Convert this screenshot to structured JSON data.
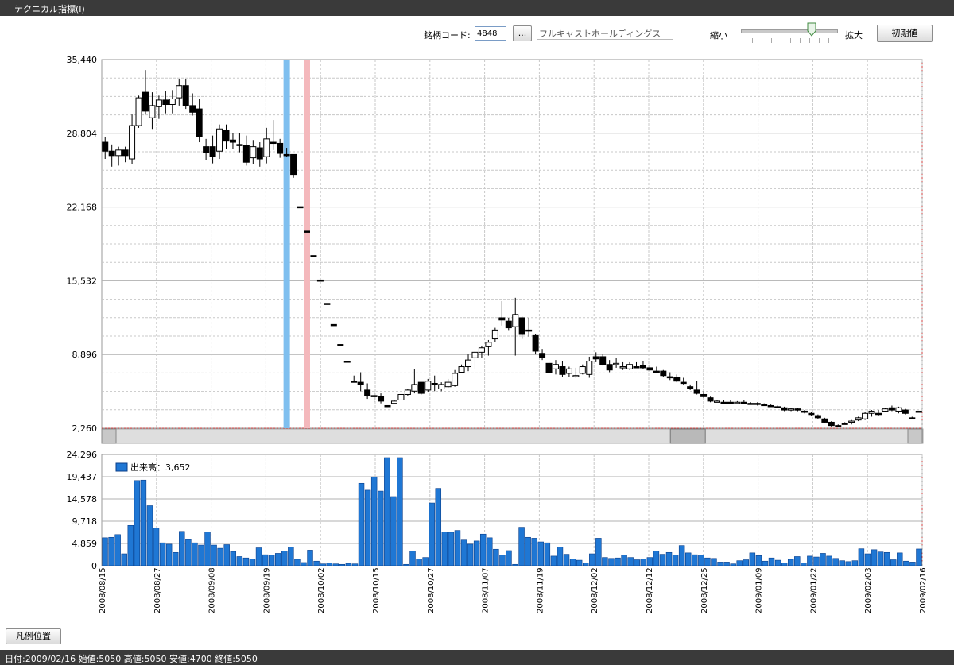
{
  "window": {
    "title": "テクニカル指標(I)"
  },
  "toolbar": {
    "code_label": "銘柄コード:",
    "code_value": "4848",
    "browse_label": "...",
    "company_name": "フルキャストホールディングス",
    "zoom_out_label": "縮小",
    "zoom_in_label": "拡大",
    "reset_label": "初期値",
    "zoom_level": 0.75
  },
  "legend_button_label": "凡例位置",
  "status_text": "日付:2009/02/16  始値:5050  高値:5050  安値:4700  終値:5050",
  "colors": {
    "volume_bar": "#1f77d4",
    "blue_marker": "#7fbfef",
    "pink_marker": "#f4b8bc",
    "up_candle": "#ffffff",
    "down_candle": "#000000",
    "grid": "#c8c8c8"
  },
  "chart_data": [
    {
      "type": "candlestick",
      "ylim": [
        2260,
        35440
      ],
      "yticks": [
        "35,440",
        "28,804",
        "22,168",
        "15,532",
        "8,896",
        "2,260"
      ],
      "markers": [
        {
          "color": "blue",
          "index": 27
        },
        {
          "color": "pink",
          "index": 30
        }
      ],
      "scrollbar_position": 0.7,
      "candles": [
        [
          28000,
          28500,
          26500,
          27200
        ],
        [
          27200,
          27800,
          25800,
          26800
        ],
        [
          26800,
          27600,
          25900,
          27300
        ],
        [
          27300,
          27600,
          26200,
          26800
        ],
        [
          26500,
          30500,
          26000,
          29500
        ],
        [
          29500,
          32200,
          29300,
          32000
        ],
        [
          32500,
          34500,
          30500,
          30800
        ],
        [
          30200,
          32500,
          29200,
          31300
        ],
        [
          31200,
          32200,
          30100,
          31800
        ],
        [
          31800,
          32600,
          30600,
          31400
        ],
        [
          31400,
          32700,
          30600,
          31900
        ],
        [
          32000,
          33700,
          31300,
          33100
        ],
        [
          33100,
          33700,
          31000,
          31300
        ],
        [
          31300,
          32400,
          30400,
          30700
        ],
        [
          31000,
          31900,
          28000,
          28500
        ],
        [
          27600,
          28300,
          26400,
          27100
        ],
        [
          27600,
          28600,
          26100,
          26700
        ],
        [
          27200,
          29600,
          26500,
          29200
        ],
        [
          29100,
          29600,
          27400,
          28100
        ],
        [
          28200,
          28800,
          27400,
          28000
        ],
        [
          27800,
          28800,
          27100,
          27700
        ],
        [
          27700,
          28600,
          25900,
          26200
        ],
        [
          26600,
          28200,
          26000,
          27600
        ],
        [
          27500,
          28000,
          25800,
          26500
        ],
        [
          26700,
          29300,
          26100,
          28300
        ],
        [
          28000,
          30000,
          27300,
          27900
        ],
        [
          27900,
          28300,
          26600,
          27000
        ],
        [
          26900,
          27500,
          26700,
          26800
        ],
        [
          26900,
          26900,
          24800,
          25100
        ],
        [
          22200,
          22200,
          22200,
          22200
        ],
        [
          20000,
          20000,
          20000,
          20000
        ],
        [
          17800,
          17800,
          17800,
          17800
        ],
        [
          15600,
          15600,
          15600,
          15600
        ],
        [
          13500,
          13500,
          13500,
          13500
        ],
        [
          11600,
          11600,
          11600,
          11600
        ],
        [
          9800,
          9800,
          9800,
          9800
        ],
        [
          8300,
          8300,
          8300,
          8300
        ],
        [
          6500,
          7000,
          6400,
          6500
        ],
        [
          6400,
          7300,
          5600,
          6200
        ],
        [
          5700,
          6300,
          4900,
          5200
        ],
        [
          5200,
          5600,
          4600,
          5100
        ],
        [
          5100,
          5400,
          4500,
          4700
        ],
        [
          4300,
          4300,
          4200,
          4300
        ],
        [
          4500,
          4800,
          4500,
          4700
        ],
        [
          4800,
          5300,
          4800,
          5300
        ],
        [
          5300,
          5800,
          5200,
          5700
        ],
        [
          5600,
          7600,
          5400,
          6200
        ],
        [
          6400,
          6400,
          5300,
          5400
        ],
        [
          5700,
          6700,
          5500,
          6500
        ],
        [
          6300,
          7000,
          5600,
          6300
        ],
        [
          5800,
          6400,
          5600,
          6200
        ],
        [
          6000,
          6700,
          5900,
          6400
        ],
        [
          6100,
          7500,
          6000,
          7200
        ],
        [
          7300,
          8000,
          7200,
          7800
        ],
        [
          7800,
          8900,
          7400,
          8400
        ],
        [
          8600,
          9200,
          7600,
          9100
        ],
        [
          9100,
          9700,
          8600,
          9500
        ],
        [
          9600,
          10200,
          8800,
          10000
        ],
        [
          10300,
          11300,
          10000,
          11100
        ],
        [
          12200,
          13700,
          11500,
          12000
        ],
        [
          11900,
          12200,
          11100,
          11300
        ],
        [
          11400,
          14000,
          8800,
          12500
        ],
        [
          12200,
          12300,
          10300,
          10700
        ],
        [
          11100,
          12200,
          10500,
          11000
        ],
        [
          10600,
          10700,
          8900,
          9200
        ],
        [
          9000,
          9400,
          8400,
          8600
        ],
        [
          8100,
          8300,
          7200,
          7300
        ],
        [
          7600,
          8400,
          7100,
          8000
        ],
        [
          7800,
          8300,
          6900,
          7100
        ],
        [
          7200,
          7800,
          6900,
          7600
        ],
        [
          6900,
          7700,
          6800,
          7000
        ],
        [
          7200,
          8000,
          7100,
          7800
        ],
        [
          7100,
          8700,
          6800,
          8300
        ],
        [
          8700,
          9100,
          8200,
          8500
        ],
        [
          8700,
          8900,
          7900,
          8000
        ],
        [
          8000,
          8400,
          7300,
          7500
        ],
        [
          8000,
          8600,
          7700,
          8100
        ],
        [
          7700,
          8200,
          7500,
          7800
        ],
        [
          7600,
          8200,
          7500,
          8000
        ],
        [
          7800,
          8200,
          7700,
          7800
        ],
        [
          7900,
          8300,
          7600,
          7700
        ],
        [
          7700,
          8000,
          7400,
          7500
        ],
        [
          7400,
          7800,
          7200,
          7400
        ],
        [
          7400,
          7500,
          6900,
          7000
        ],
        [
          6900,
          7300,
          6600,
          6800
        ],
        [
          6800,
          7100,
          6400,
          6500
        ],
        [
          6400,
          6800,
          6200,
          6300
        ],
        [
          6000,
          6200,
          5700,
          5800
        ],
        [
          5700,
          6500,
          5300,
          5400
        ],
        [
          5300,
          5600,
          5000,
          5100
        ],
        [
          5000,
          5100,
          4600,
          4700
        ],
        [
          4600,
          4800,
          4600,
          4700
        ],
        [
          4600,
          4800,
          4500,
          4600
        ],
        [
          4600,
          4800,
          4500,
          4600
        ],
        [
          4500,
          4700,
          4500,
          4600
        ],
        [
          4600,
          4800,
          4500,
          4600
        ],
        [
          4500,
          4600,
          4400,
          4500
        ],
        [
          4400,
          4600,
          4300,
          4500
        ],
        [
          4400,
          4500,
          4300,
          4400
        ],
        [
          4300,
          4400,
          4200,
          4200
        ],
        [
          4200,
          4300,
          4100,
          4200
        ],
        [
          4100,
          4200,
          3800,
          3900
        ],
        [
          3900,
          4100,
          3800,
          4000
        ],
        [
          4000,
          4100,
          3800,
          3900
        ],
        [
          3800,
          3900,
          3600,
          3700
        ],
        [
          3600,
          3700,
          3400,
          3500
        ],
        [
          3400,
          3500,
          3100,
          3200
        ],
        [
          3100,
          3200,
          2700,
          2800
        ],
        [
          2800,
          2900,
          2400,
          2500
        ],
        [
          2500,
          2600,
          2400,
          2500
        ],
        [
          2700,
          2800,
          2600,
          2700
        ],
        [
          2800,
          3000,
          2600,
          2900
        ],
        [
          3000,
          3300,
          2900,
          3200
        ],
        [
          3100,
          3700,
          3000,
          3600
        ],
        [
          3600,
          3900,
          3300,
          3800
        ],
        [
          3600,
          3900,
          3400,
          3500
        ],
        [
          3800,
          4100,
          3700,
          4000
        ],
        [
          4100,
          4300,
          3800,
          3900
        ],
        [
          3800,
          4200,
          3600,
          4100
        ],
        [
          3900,
          4000,
          3500,
          3600
        ],
        [
          3200,
          3300,
          3100,
          3200
        ],
        [
          3700,
          3800,
          3700,
          3800
        ]
      ]
    },
    {
      "type": "bar",
      "series": [
        {
          "name": "出来高",
          "latest_label": "3,652"
        }
      ],
      "ylim": [
        0,
        24296
      ],
      "yticks": [
        "24,296",
        "19,437",
        "14,578",
        "9,718",
        "4,859",
        "0"
      ],
      "xticks": [
        "2008/08/15",
        "2008/08/27",
        "2008/09/08",
        "2008/09/19",
        "2008/10/02",
        "2008/10/15",
        "2008/10/27",
        "2008/11/07",
        "2008/11/19",
        "2008/12/02",
        "2008/12/12",
        "2008/12/25",
        "2009/01/09",
        "2009/01/22",
        "2009/02/03",
        "2009/02/16"
      ],
      "values": [
        6100,
        6200,
        6800,
        2600,
        8800,
        18600,
        18700,
        13100,
        8200,
        5000,
        4700,
        2900,
        7500,
        5700,
        5000,
        4500,
        7400,
        4500,
        3800,
        4600,
        3100,
        2000,
        1700,
        1500,
        3900,
        2400,
        2300,
        2700,
        3200,
        4100,
        1400,
        700,
        3400,
        1000,
        400,
        600,
        400,
        300,
        500,
        400,
        18000,
        16500,
        19400,
        16300,
        23600,
        15100,
        23600,
        300,
        3200,
        1500,
        1800,
        13700,
        16900,
        7400,
        7300,
        7700,
        5600,
        4700,
        5400,
        6900,
        6100,
        3600,
        2300,
        3300,
        300,
        8400,
        6200,
        6000,
        5200,
        5000,
        2100,
        4100,
        2500,
        1500,
        1200,
        600,
        2600,
        6000,
        1800,
        1600,
        1700,
        2300,
        1800,
        1300,
        1500,
        1800,
        3200,
        2500,
        2900,
        2300,
        4400,
        2800,
        2400,
        2300,
        1700,
        1600,
        800,
        800,
        400,
        1100,
        1300,
        2800,
        2200,
        1000,
        1700,
        1200,
        600,
        1400,
        2000,
        600,
        2100,
        1900,
        2700,
        2100,
        1600,
        1100,
        900,
        1100,
        3700,
        2600,
        3500,
        3000,
        2900,
        1300,
        2800,
        1000,
        800,
        3652
      ]
    }
  ]
}
